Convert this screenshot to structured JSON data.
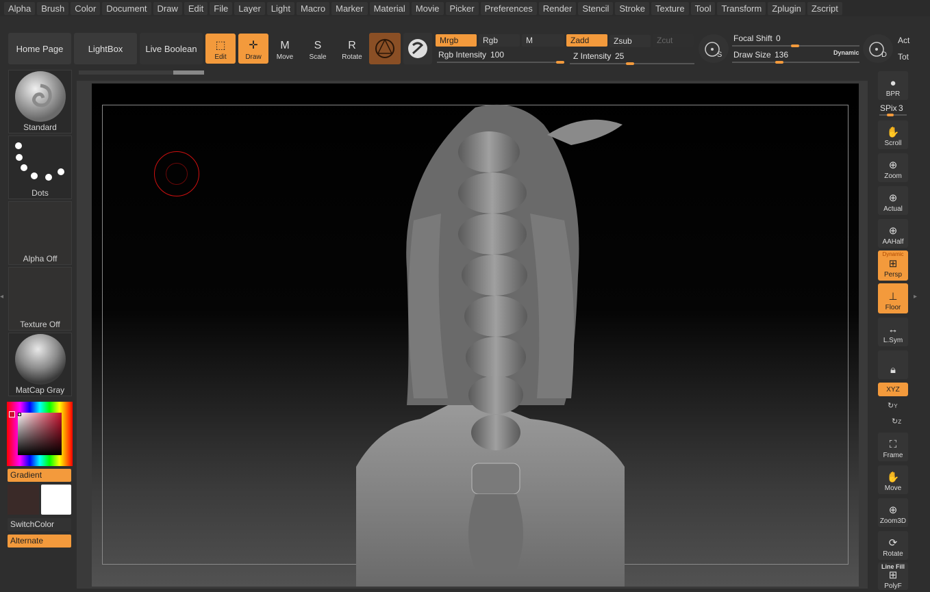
{
  "menu": [
    "Alpha",
    "Brush",
    "Color",
    "Document",
    "Draw",
    "Edit",
    "File",
    "Layer",
    "Light",
    "Macro",
    "Marker",
    "Material",
    "Movie",
    "Picker",
    "Preferences",
    "Render",
    "Stencil",
    "Stroke",
    "Texture",
    "Tool",
    "Transform",
    "Zplugin",
    "Zscript"
  ],
  "toolbar": {
    "home_page": "Home Page",
    "lightbox": "LightBox",
    "live_boolean": "Live Boolean",
    "edit": "Edit",
    "draw": "Draw",
    "move": "Move",
    "scale": "Scale",
    "rotate": "Rotate",
    "move_key": "M",
    "scale_key": "S",
    "rotate_key": "R",
    "mrgb": "Mrgb",
    "rgb": "Rgb",
    "m": "M",
    "zadd": "Zadd",
    "zsub": "Zsub",
    "zcut": "Zcut",
    "rgb_intensity_label": "Rgb Intensity",
    "rgb_intensity_value": "100",
    "z_intensity_label": "Z Intensity",
    "z_intensity_value": "25",
    "focal_shift_label": "Focal Shift",
    "focal_shift_value": "0",
    "draw_size_label": "Draw Size",
    "draw_size_value": "136",
    "dynamic": "Dynamic",
    "s_key": "S",
    "d_key": "D",
    "act": "Act",
    "tot": "Tot"
  },
  "left_panel": {
    "brush": "Standard",
    "stroke": "Dots",
    "alpha": "Alpha Off",
    "texture": "Texture Off",
    "material": "MatCap Gray",
    "gradient": "Gradient",
    "switch_color": "SwitchColor",
    "alternate": "Alternate"
  },
  "right_shelf": {
    "bpr": "BPR",
    "spix_label": "SPix",
    "spix_value": "3",
    "scroll": "Scroll",
    "zoom": "Zoom",
    "actual": "Actual",
    "aahalf": "AAHalf",
    "dynamic": "Dynamic",
    "persp": "Persp",
    "floor": "Floor",
    "lsym": "L.Sym",
    "xyz": "XYZ",
    "y_axis": "Y",
    "z_axis": "Z",
    "frame": "Frame",
    "move": "Move",
    "zoom3d": "Zoom3D",
    "rotate": "Rotate",
    "line_fill": "Line Fill",
    "polyf": "PolyF"
  },
  "colors": {
    "accent": "#f39a3c",
    "brush_cursor": "#d01010"
  }
}
